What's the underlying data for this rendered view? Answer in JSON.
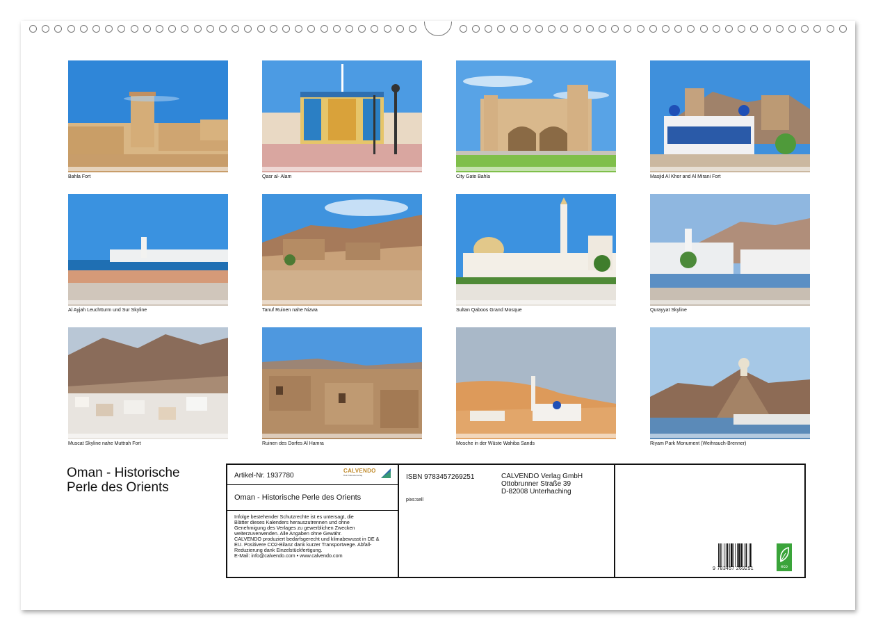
{
  "photos": [
    {
      "id": "bahla-fort",
      "caption": "Bahla Fort"
    },
    {
      "id": "qasr-al-alam",
      "caption": "Qasr al- Alam"
    },
    {
      "id": "city-gate-bahla",
      "caption": "City Gate Bahla"
    },
    {
      "id": "masjid-al-khor",
      "caption": "Masjid Al Khor and Al Mirani Fort"
    },
    {
      "id": "al-ayjah",
      "caption": "Al Ayjah Leuchtturm und Sur Skyline"
    },
    {
      "id": "tanuf",
      "caption": "Tanuf Ruinen nahe Nizwa"
    },
    {
      "id": "sultan-qaboos",
      "caption": "Sultan Qaboos Grand Mosque"
    },
    {
      "id": "qurayyat",
      "caption": "Qurayyat Skyline"
    },
    {
      "id": "muscat",
      "caption": "Muscat Skyline nahe Muttrah Fort"
    },
    {
      "id": "al-hamra",
      "caption": "Ruinen des Dorfes Al Hamra"
    },
    {
      "id": "wahiba",
      "caption": "Mosche in der Wüste Wahiba Sands"
    },
    {
      "id": "riyam",
      "caption": "Riyam Park Monument (Weihrauch-Brenner)"
    }
  ],
  "title_line1": "Oman - Historische",
  "title_line2": "Perle des Orients",
  "info": {
    "article_number": "Artikel-Nr. 1937780",
    "brand": "CALVENDO",
    "brand_tagline": "Dein Kalenderverlag",
    "small_title": "Oman - Historische Perle des Orients",
    "legal": [
      "Infolge bestehender Schutzrechte ist es untersagt, die",
      "Blätter dieses Kalenders herauszutrennen und ohne",
      "Genehmigung des Verlages zu gewerblichen Zwecken",
      "weiterzuverwenden. Alle Angaben ohne Gewähr.",
      "CALVENDO produziert bedarfsgerecht und klimabewusst in DE &",
      "EU. Positivere CO2-Bilanz dank kurzer Transportwege. Abfall-",
      "Reduzierung dank Einzelstückfertigung.",
      "E-Mail: info@calvendo.com • www.calvendo.com"
    ],
    "isbn": "ISBN 9783457269251",
    "publisher_name": "CALVENDO Verlag GmbH",
    "publisher_street": "Ottobrunner Straße 39",
    "publisher_city": "D-82008 Unterhaching",
    "photographer": "pixs:sell",
    "barcode_digits": "9   783457   269251",
    "eco_label": "eco"
  },
  "colors": {
    "sky": "#3f8fd6",
    "sand": "#d7b07a",
    "brand_gold": "#c08a2a",
    "eco_green": "#3aa43a"
  }
}
